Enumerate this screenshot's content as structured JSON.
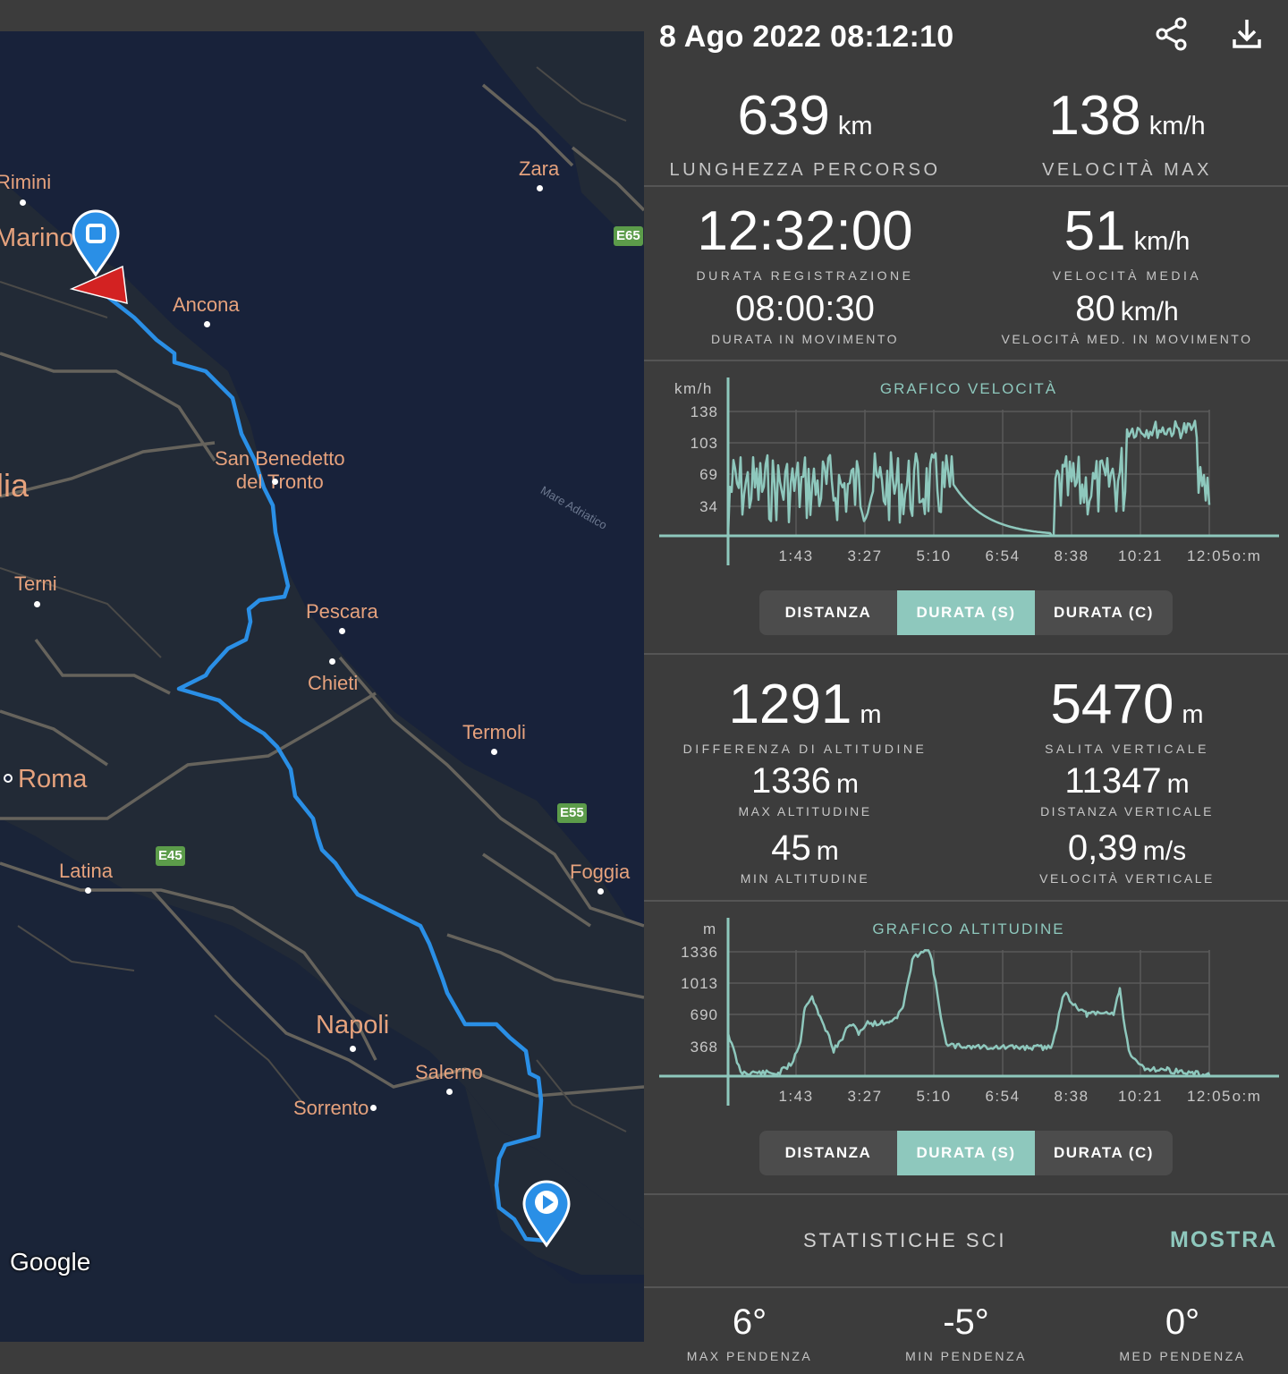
{
  "map": {
    "cities": [
      {
        "name": "Rimini",
        "big": false
      },
      {
        "name": "Marino",
        "big": true
      },
      {
        "name": "Zara",
        "big": false
      },
      {
        "name": "Ancona",
        "big": false
      },
      {
        "name": "San Benedetto\ndel Tronto",
        "big": false
      },
      {
        "name": "lia",
        "big": true
      },
      {
        "name": "Terni",
        "big": false
      },
      {
        "name": "Pescara",
        "big": false
      },
      {
        "name": "Chieti",
        "big": false
      },
      {
        "name": "Termoli",
        "big": false
      },
      {
        "name": "Roma",
        "big": true
      },
      {
        "name": "Latina",
        "big": false
      },
      {
        "name": "Foggia",
        "big": false
      },
      {
        "name": "Napoli",
        "big": true
      },
      {
        "name": "Salerno",
        "big": false
      },
      {
        "name": "Sorrento",
        "big": false
      }
    ],
    "shields": [
      "E65",
      "E55",
      "E45"
    ],
    "sea_label": "Mare Adriatico",
    "logo": "Google",
    "route_color": "#2a8fe6",
    "marker_color": "#2a8fe6",
    "arrow_color": "#d32222"
  },
  "header": {
    "title": "8 Ago 2022 08:12:10",
    "share_icon": "share-icon",
    "download_icon": "download-icon"
  },
  "stats_top": {
    "distance": {
      "value": "639",
      "unit": "km",
      "label": "LUNGHEZZA PERCORSO"
    },
    "max_speed": {
      "value": "138",
      "unit": "km/h",
      "label": "VELOCITÀ MAX"
    }
  },
  "stats_time": {
    "duration": {
      "value": "12:32:00",
      "label": "DURATA REGISTRAZIONE"
    },
    "avg_speed": {
      "value": "51",
      "unit": "km/h",
      "label": "VELOCITÀ MEDIA"
    },
    "moving_duration": {
      "value": "08:00:30",
      "label": "DURATA IN MOVIMENTO"
    },
    "moving_avg_speed": {
      "value": "80",
      "unit": "km/h",
      "label": "VELOCITÀ MED. IN MOVIMENTO"
    }
  },
  "speed_chart": {
    "title": "GRAFICO VELOCITÀ",
    "unit": "km/h",
    "y_ticks": [
      "138",
      "103",
      "69",
      "34"
    ],
    "x_ticks": [
      "1:43",
      "3:27",
      "5:10",
      "6:54",
      "8:38",
      "10:21",
      "12:05"
    ],
    "x_unit": "o:m",
    "color": "#8ec8bd"
  },
  "speed_toggle": {
    "options": [
      "DISTANZA",
      "DURATA (S)",
      "DURATA (C)"
    ],
    "active": 1
  },
  "stats_alt": {
    "alt_diff": {
      "value": "1291",
      "unit": "m",
      "label": "DIFFERENZA DI ALTITUDINE"
    },
    "vert_climb": {
      "value": "5470",
      "unit": "m",
      "label": "SALITA VERTICALE"
    },
    "max_alt": {
      "value": "1336",
      "unit": "m",
      "label": "MAX ALTITUDINE"
    },
    "vert_dist": {
      "value": "11347",
      "unit": "m",
      "label": "DISTANZA VERTICALE"
    },
    "min_alt": {
      "value": "45",
      "unit": "m",
      "label": "MIN ALTITUDINE"
    },
    "vert_speed": {
      "value": "0,39",
      "unit": "m/s",
      "label": "VELOCITÀ VERTICALE"
    }
  },
  "alt_chart": {
    "title": "GRAFICO ALTITUDINE",
    "unit": "m",
    "y_ticks": [
      "1336",
      "1013",
      "690",
      "368"
    ],
    "x_ticks": [
      "1:43",
      "3:27",
      "5:10",
      "6:54",
      "8:38",
      "10:21",
      "12:05"
    ],
    "x_unit": "o:m",
    "color": "#8ec8bd"
  },
  "alt_toggle": {
    "options": [
      "DISTANZA",
      "DURATA (S)",
      "DURATA (C)"
    ],
    "active": 1
  },
  "ski": {
    "label": "STATISTICHE SCI",
    "button": "MOSTRA"
  },
  "slopes": {
    "max": {
      "value": "6°",
      "label": "MAX PENDENZA"
    },
    "min": {
      "value": "-5°",
      "label": "MIN PENDENZA"
    },
    "avg": {
      "value": "0°",
      "label": "MED PENDENZA"
    }
  }
}
